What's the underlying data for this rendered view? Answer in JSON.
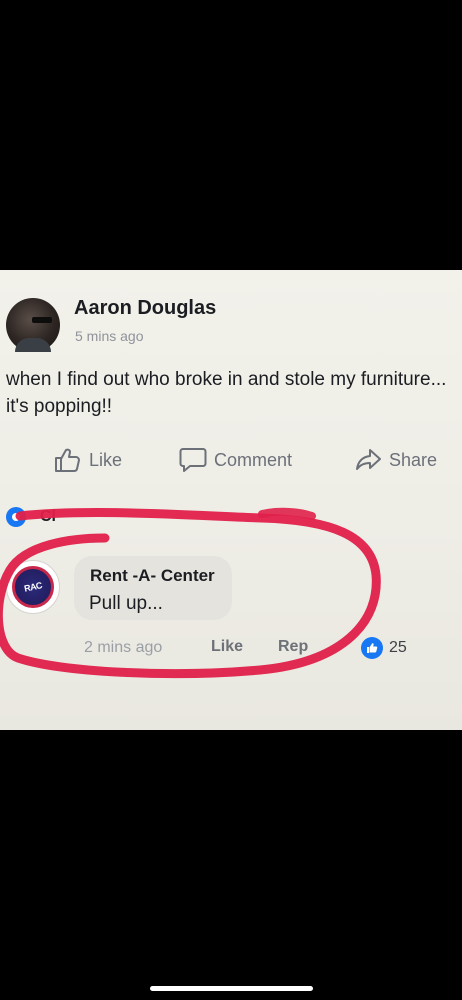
{
  "post": {
    "author": "Aaron Douglas",
    "time": "5 mins ago",
    "text": "when I find out who broke in and stole my furniture... it's popping!!"
  },
  "actions": {
    "like": "Like",
    "comment": "Comment",
    "share": "Share"
  },
  "collapsed_comments": {
    "text": "Cl"
  },
  "comment": {
    "author": "Rent -A- Center",
    "text": "Pull up...",
    "time": "2 mins ago",
    "like_label": "Like",
    "reply_label": "Rep",
    "reaction_count": "25",
    "avatar_logo_text": "RAC"
  },
  "colors": {
    "annotation_circle": "#e0204a",
    "reaction_blue": "#1877f2"
  },
  "icons": {
    "like": "thumbs-up-icon",
    "comment": "speech-bubble-icon",
    "share": "share-arrow-icon",
    "reaction": "like-reaction-icon"
  }
}
